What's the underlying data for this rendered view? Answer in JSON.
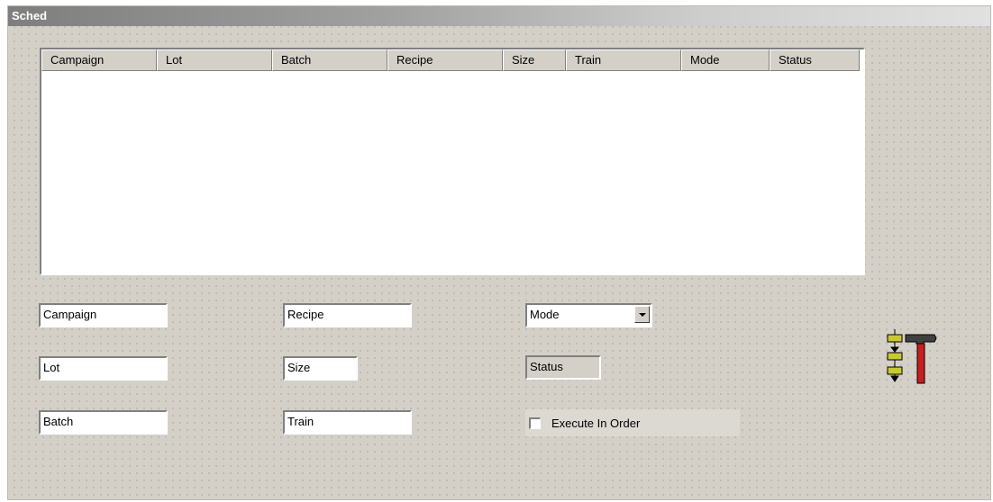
{
  "window": {
    "title": "Sched"
  },
  "listview": {
    "columns": [
      "Campaign",
      "Lot",
      "Batch",
      "Recipe",
      "Size",
      "Train",
      "Mode",
      "Status"
    ],
    "rows": []
  },
  "fields": {
    "campaign": "Campaign",
    "lot": "Lot",
    "batch": "Batch",
    "recipe": "Recipe",
    "size": "Size",
    "train": "Train"
  },
  "mode_select": {
    "value": "Mode"
  },
  "status_label": "Status",
  "execute_in_order": {
    "label": "Execute In Order",
    "checked": false
  },
  "icons": {
    "tool": "hammer-and-sequence-icon"
  },
  "colors": {
    "background": "#d4d0c8",
    "hammer_head": "#404040",
    "hammer_handle": "#c81e1e",
    "sequence": "#c8c832"
  }
}
